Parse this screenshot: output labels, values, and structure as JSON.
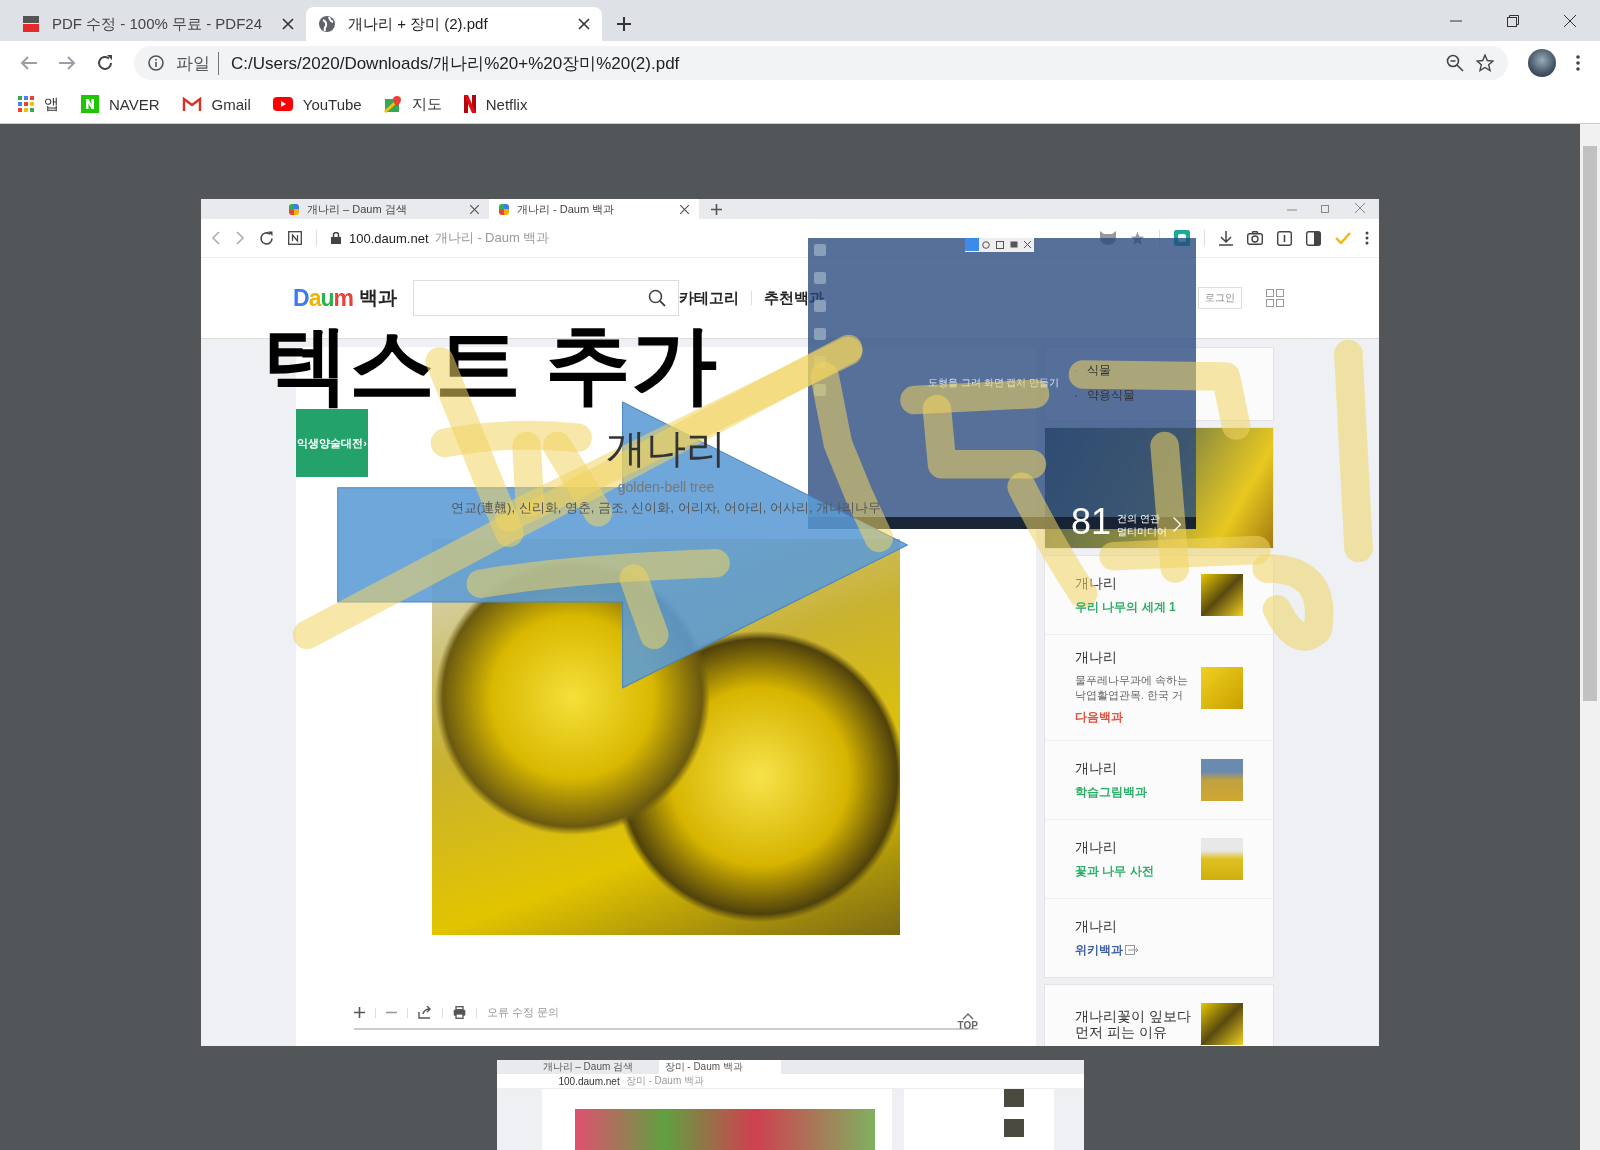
{
  "browser": {
    "tabs": [
      {
        "title": "PDF 수정 - 100% 무료 - PDF24",
        "selected": false
      },
      {
        "title": "개나리 + 장미 (2).pdf",
        "selected": true
      }
    ],
    "address": {
      "scheme_label": "파일",
      "url": "C:/Users/2020/Downloads/개나리%20+%20장미%20(2).pdf"
    },
    "bookmarks": [
      {
        "label": "앱"
      },
      {
        "label": "NAVER"
      },
      {
        "label": "Gmail"
      },
      {
        "label": "YouTube"
      },
      {
        "label": "지도"
      },
      {
        "label": "Netflix"
      }
    ]
  },
  "pdf_pages": [
    {
      "browser_tabs": [
        {
          "title": "개나리 – Daum 검색",
          "selected": false
        },
        {
          "title": "개나리 - Daum 백과",
          "selected": true
        }
      ],
      "host": "100.daum.net",
      "page_title": "개나리 - Daum 백과",
      "header": {
        "logo": "Daum",
        "section": "백과",
        "nav": [
          "카테고리",
          "추천백과"
        ],
        "login": "로그인"
      },
      "article": {
        "banner": "익생양술대전›",
        "title": "개나리",
        "subtitle": "golden-bell tree",
        "synonyms": "연교(連翹), 신리화, 영춘, 금조, 신이화, 어리자, 어아리, 어사리, 개나리나무",
        "report": "오류 수정 문의",
        "top": "TOP"
      },
      "sidebar": {
        "categories": [
          "식물",
          "약용식물"
        ],
        "media": {
          "count": "81",
          "line1": "건의 연관",
          "line2": "멀티미디어"
        },
        "results": [
          {
            "title": "개나리",
            "source": "우리 나무의 세계 1",
            "color": "#2bae66",
            "thumbnail": true
          },
          {
            "title": "개나리",
            "description": "물푸레나무과에 속하는 낙엽활엽관목. 한국 거",
            "source": "다음백과",
            "color": "#e0503c",
            "thumbnail": true
          },
          {
            "title": "개나리",
            "source": "학습그림백과",
            "color": "#2bae66",
            "thumbnail": true
          },
          {
            "title": "개나리",
            "source": "꽃과 나무 사전",
            "color": "#2bae66",
            "thumbnail": true
          },
          {
            "title": "개나리",
            "source": "위키백과",
            "color": "#3d5ea8",
            "thumbnail": false
          }
        ],
        "extra": {
          "title": "개나리꽃이 잎보다 먼저 피는 이유"
        }
      },
      "annotations": {
        "text": "텍스트 추가",
        "capture_hint": "도형을 그려 화면 캡처 만들기"
      }
    },
    {
      "browser_tabs": [
        {
          "title": "개나리 – Daum 검색",
          "selected": false
        },
        {
          "title": "장미 - Daum 백과",
          "selected": true
        }
      ],
      "host": "100.daum.net",
      "page_title": "장미 - Daum 백과"
    }
  ]
}
